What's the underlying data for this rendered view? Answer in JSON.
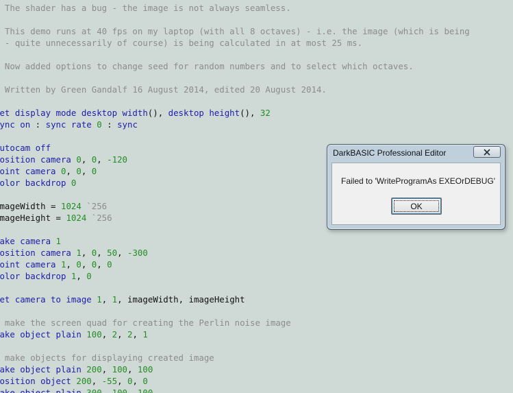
{
  "editor": {
    "lines": [
      [
        {
          "t": "c",
          "s": "  The shader has a bug - the image is not always seamless."
        }
      ],
      [],
      [
        {
          "t": "c",
          "s": "  This demo runs at 40 fps on my laptop (with all 8 octaves) - i.e. the image (which is being"
        }
      ],
      [
        {
          "t": "c",
          "s": "  - quite unnecessarily of course) is being calculated in at most 25 ms."
        }
      ],
      [],
      [
        {
          "t": "c",
          "s": "  Now added options to change seed for random numbers and to select which octaves."
        }
      ],
      [],
      [
        {
          "t": "c",
          "s": "  Written by Green Gandalf 16 August 2014, edited 20 August 2014."
        }
      ],
      [],
      [
        {
          "t": "k",
          "s": "set display mode desktop width"
        },
        {
          "t": "p",
          "s": "(), "
        },
        {
          "t": "k",
          "s": "desktop height"
        },
        {
          "t": "p",
          "s": "(), "
        },
        {
          "t": "n",
          "s": "32"
        }
      ],
      [
        {
          "t": "k",
          "s": "sync on"
        },
        {
          "t": "p",
          "s": " : "
        },
        {
          "t": "k",
          "s": "sync rate"
        },
        {
          "t": "p",
          "s": " "
        },
        {
          "t": "n",
          "s": "0"
        },
        {
          "t": "p",
          "s": " : "
        },
        {
          "t": "k",
          "s": "sync"
        }
      ],
      [],
      [
        {
          "t": "k",
          "s": "autocam off"
        }
      ],
      [
        {
          "t": "k",
          "s": "position camera"
        },
        {
          "t": "p",
          "s": " "
        },
        {
          "t": "n",
          "s": "0"
        },
        {
          "t": "p",
          "s": ", "
        },
        {
          "t": "n",
          "s": "0"
        },
        {
          "t": "p",
          "s": ", "
        },
        {
          "t": "n",
          "s": "-120"
        }
      ],
      [
        {
          "t": "k",
          "s": "point camera"
        },
        {
          "t": "p",
          "s": " "
        },
        {
          "t": "n",
          "s": "0"
        },
        {
          "t": "p",
          "s": ", "
        },
        {
          "t": "n",
          "s": "0"
        },
        {
          "t": "p",
          "s": ", "
        },
        {
          "t": "n",
          "s": "0"
        }
      ],
      [
        {
          "t": "k",
          "s": "color backdrop"
        },
        {
          "t": "p",
          "s": " "
        },
        {
          "t": "n",
          "s": "0"
        }
      ],
      [],
      [
        {
          "t": "p",
          "s": "imageWidth = "
        },
        {
          "t": "n",
          "s": "1024"
        },
        {
          "t": "c",
          "s": " `256"
        }
      ],
      [
        {
          "t": "p",
          "s": "imageHeight = "
        },
        {
          "t": "n",
          "s": "1024"
        },
        {
          "t": "c",
          "s": " `256"
        }
      ],
      [],
      [
        {
          "t": "k",
          "s": "make camera"
        },
        {
          "t": "p",
          "s": " "
        },
        {
          "t": "n",
          "s": "1"
        }
      ],
      [
        {
          "t": "k",
          "s": "position camera"
        },
        {
          "t": "p",
          "s": " "
        },
        {
          "t": "n",
          "s": "1"
        },
        {
          "t": "p",
          "s": ", "
        },
        {
          "t": "n",
          "s": "0"
        },
        {
          "t": "p",
          "s": ", "
        },
        {
          "t": "n",
          "s": "50"
        },
        {
          "t": "p",
          "s": ", "
        },
        {
          "t": "n",
          "s": "-300"
        }
      ],
      [
        {
          "t": "k",
          "s": "point camera"
        },
        {
          "t": "p",
          "s": " "
        },
        {
          "t": "n",
          "s": "1"
        },
        {
          "t": "p",
          "s": ", "
        },
        {
          "t": "n",
          "s": "0"
        },
        {
          "t": "p",
          "s": ", "
        },
        {
          "t": "n",
          "s": "0"
        },
        {
          "t": "p",
          "s": ", "
        },
        {
          "t": "n",
          "s": "0"
        }
      ],
      [
        {
          "t": "k",
          "s": "color backdrop"
        },
        {
          "t": "p",
          "s": " "
        },
        {
          "t": "n",
          "s": "1"
        },
        {
          "t": "p",
          "s": ", "
        },
        {
          "t": "n",
          "s": "0"
        }
      ],
      [],
      [
        {
          "t": "k",
          "s": "set camera to image"
        },
        {
          "t": "p",
          "s": " "
        },
        {
          "t": "n",
          "s": "1"
        },
        {
          "t": "p",
          "s": ", "
        },
        {
          "t": "n",
          "s": "1"
        },
        {
          "t": "p",
          "s": ", imageWidth, imageHeight"
        }
      ],
      [],
      [
        {
          "t": "c",
          "s": "` make the screen quad for creating the Perlin noise image"
        }
      ],
      [
        {
          "t": "k",
          "s": "make object plain"
        },
        {
          "t": "p",
          "s": " "
        },
        {
          "t": "n",
          "s": "100"
        },
        {
          "t": "p",
          "s": ", "
        },
        {
          "t": "n",
          "s": "2"
        },
        {
          "t": "p",
          "s": ", "
        },
        {
          "t": "n",
          "s": "2"
        },
        {
          "t": "p",
          "s": ", "
        },
        {
          "t": "n",
          "s": "1"
        }
      ],
      [],
      [
        {
          "t": "c",
          "s": "` make objects for displaying created image"
        }
      ],
      [
        {
          "t": "k",
          "s": "make object plain"
        },
        {
          "t": "p",
          "s": " "
        },
        {
          "t": "n",
          "s": "200"
        },
        {
          "t": "p",
          "s": ", "
        },
        {
          "t": "n",
          "s": "100"
        },
        {
          "t": "p",
          "s": ", "
        },
        {
          "t": "n",
          "s": "100"
        }
      ],
      [
        {
          "t": "k",
          "s": "position object"
        },
        {
          "t": "p",
          "s": " "
        },
        {
          "t": "n",
          "s": "200"
        },
        {
          "t": "p",
          "s": ", "
        },
        {
          "t": "n",
          "s": "-55"
        },
        {
          "t": "p",
          "s": ", "
        },
        {
          "t": "n",
          "s": "0"
        },
        {
          "t": "p",
          "s": ", "
        },
        {
          "t": "n",
          "s": "0"
        }
      ],
      [
        {
          "t": "k",
          "s": "make object plain"
        },
        {
          "t": "p",
          "s": " "
        },
        {
          "t": "n",
          "s": "300"
        },
        {
          "t": "p",
          "s": ", "
        },
        {
          "t": "n",
          "s": "100"
        },
        {
          "t": "p",
          "s": ", "
        },
        {
          "t": "n",
          "s": "100"
        }
      ]
    ]
  },
  "dialog": {
    "title": "DarkBASIC Professional Editor",
    "message": "Failed to 'WriteProgramAs EXEOrDEBUG'",
    "ok_label": "OK",
    "close_icon": "close-icon"
  },
  "colors": {
    "background": "#cfdad6",
    "comment": "#8c8c8c",
    "keyword": "#1d1dad",
    "number": "#238d23"
  }
}
